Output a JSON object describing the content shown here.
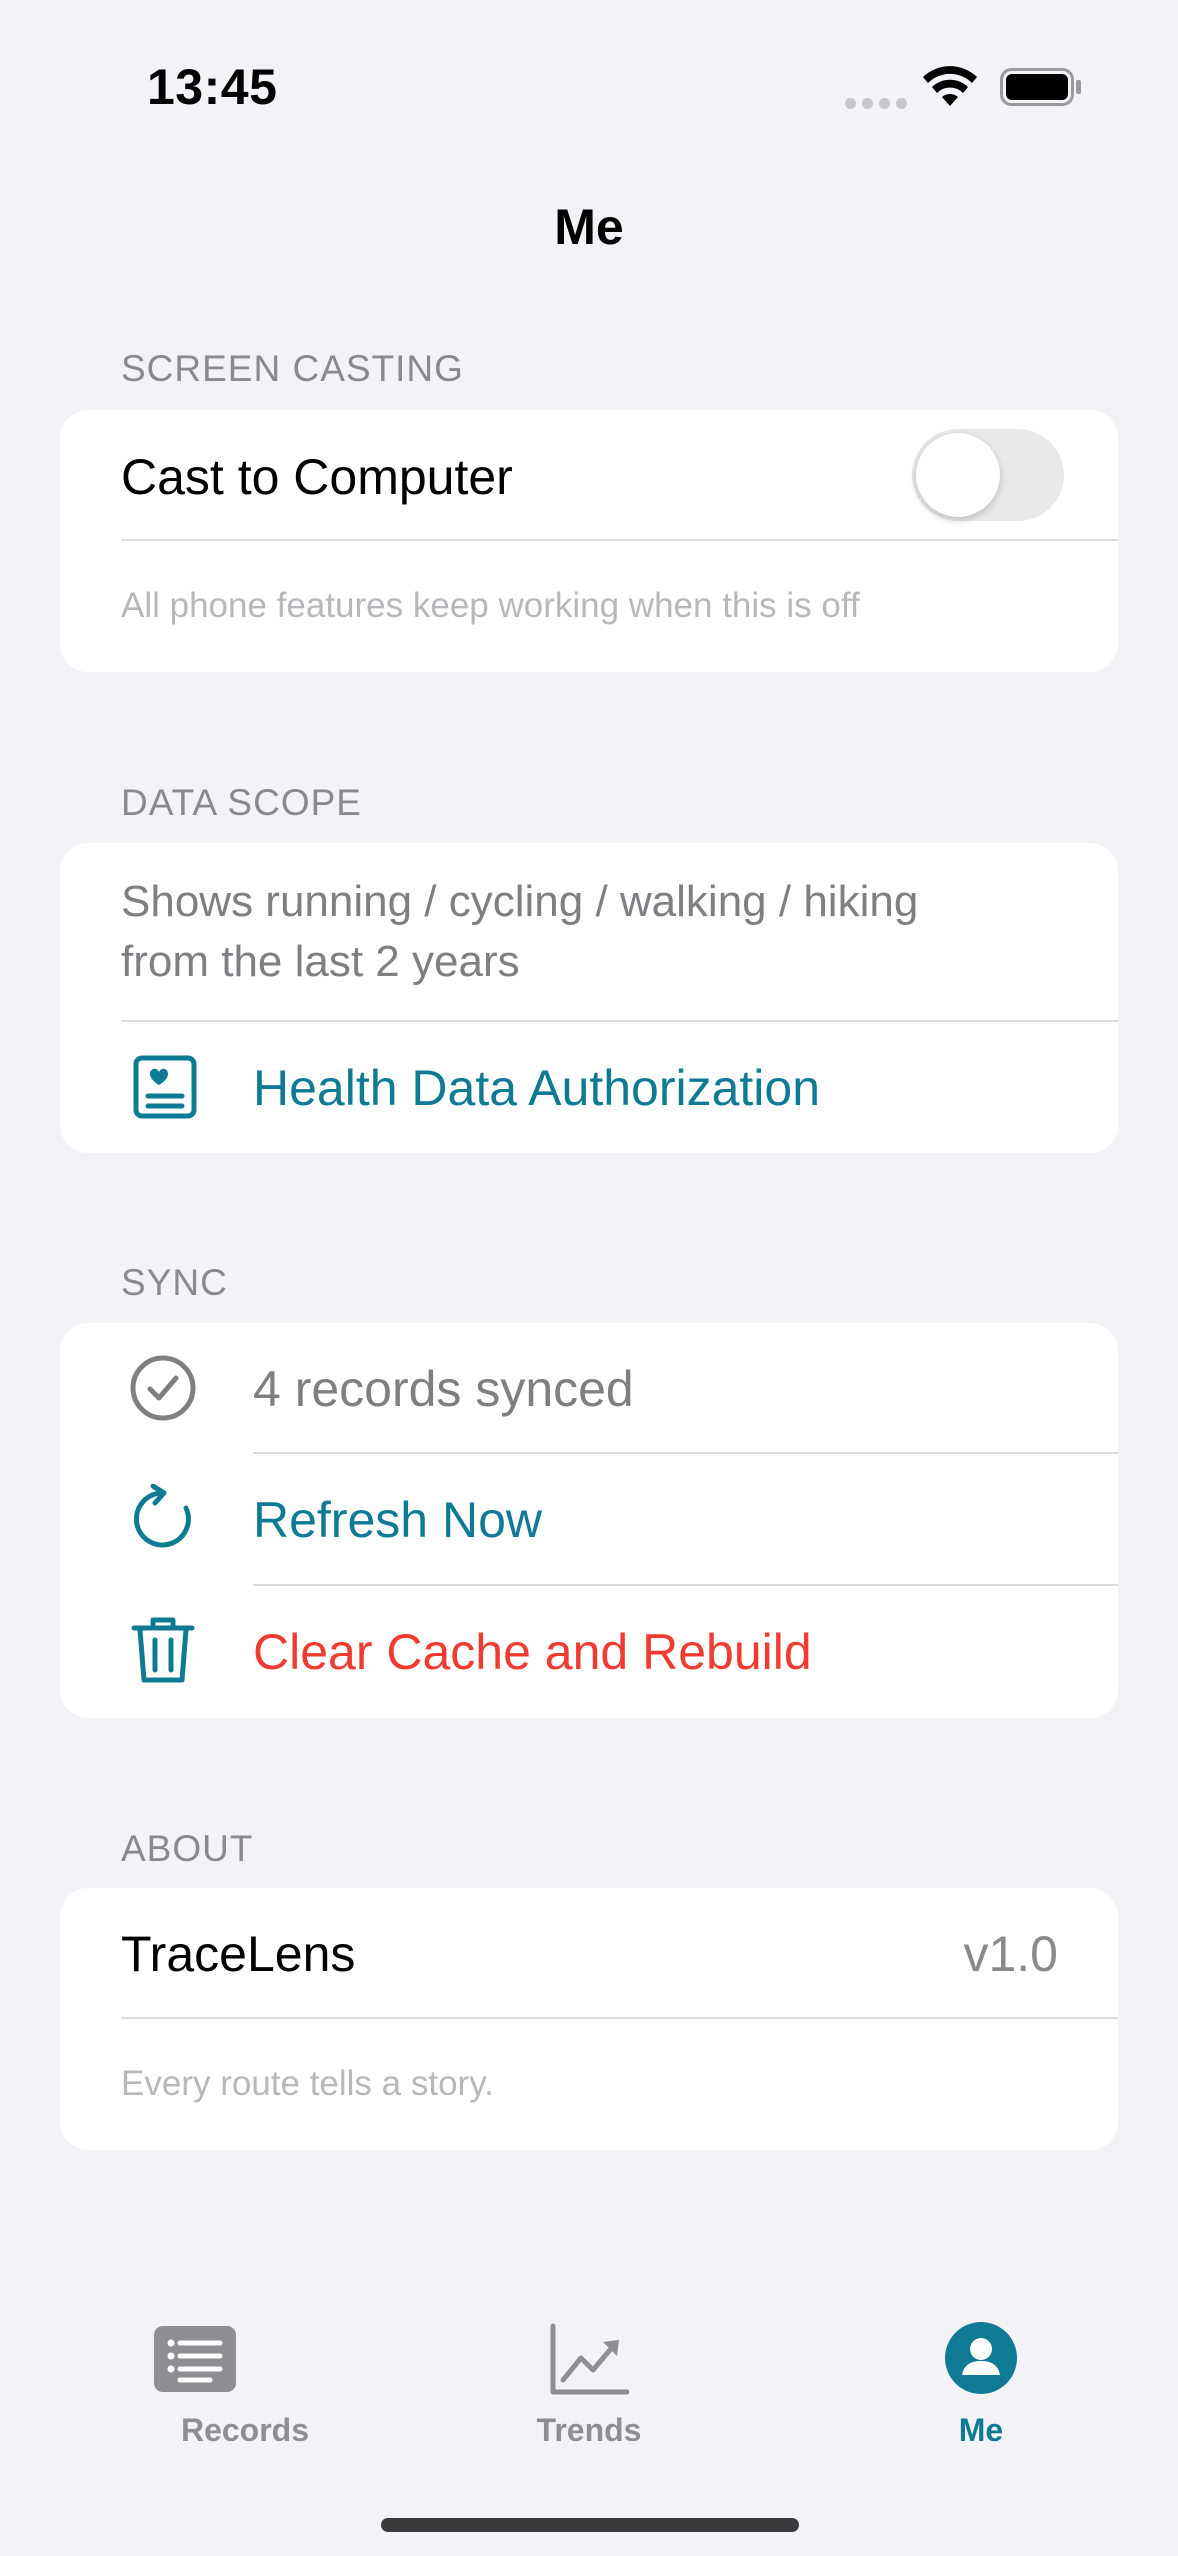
{
  "status_bar": {
    "time": "13:45"
  },
  "nav": {
    "title": "Me"
  },
  "sections": {
    "screen_casting": {
      "header": "SCREEN CASTING",
      "row_label": "Cast to Computer",
      "toggle_on": false,
      "footer": "All phone features keep working when this is off"
    },
    "data_scope": {
      "header": "DATA SCOPE",
      "description_line1": "Shows running / cycling / walking / hiking",
      "description_line2": "from the last 2 years",
      "authorization_label": "Health Data Authorization"
    },
    "sync": {
      "header": "SYNC",
      "status": "4 records synced",
      "refresh_label": "Refresh Now",
      "clear_label": "Clear Cache and Rebuild"
    },
    "about": {
      "header": "ABOUT",
      "app_name": "TraceLens",
      "version": "v1.0",
      "tagline": "Every route tells a story."
    }
  },
  "tab_bar": {
    "items": [
      {
        "label": "Records",
        "icon": "list-icon",
        "selected": false
      },
      {
        "label": "Trends",
        "icon": "chart-icon",
        "selected": false
      },
      {
        "label": "Me",
        "icon": "person-icon",
        "selected": true
      }
    ]
  },
  "colors": {
    "accent": "#0f7a93",
    "danger": "#f23b30",
    "inactive_tab": "#8e8e93",
    "background": "#f2f2f7"
  }
}
